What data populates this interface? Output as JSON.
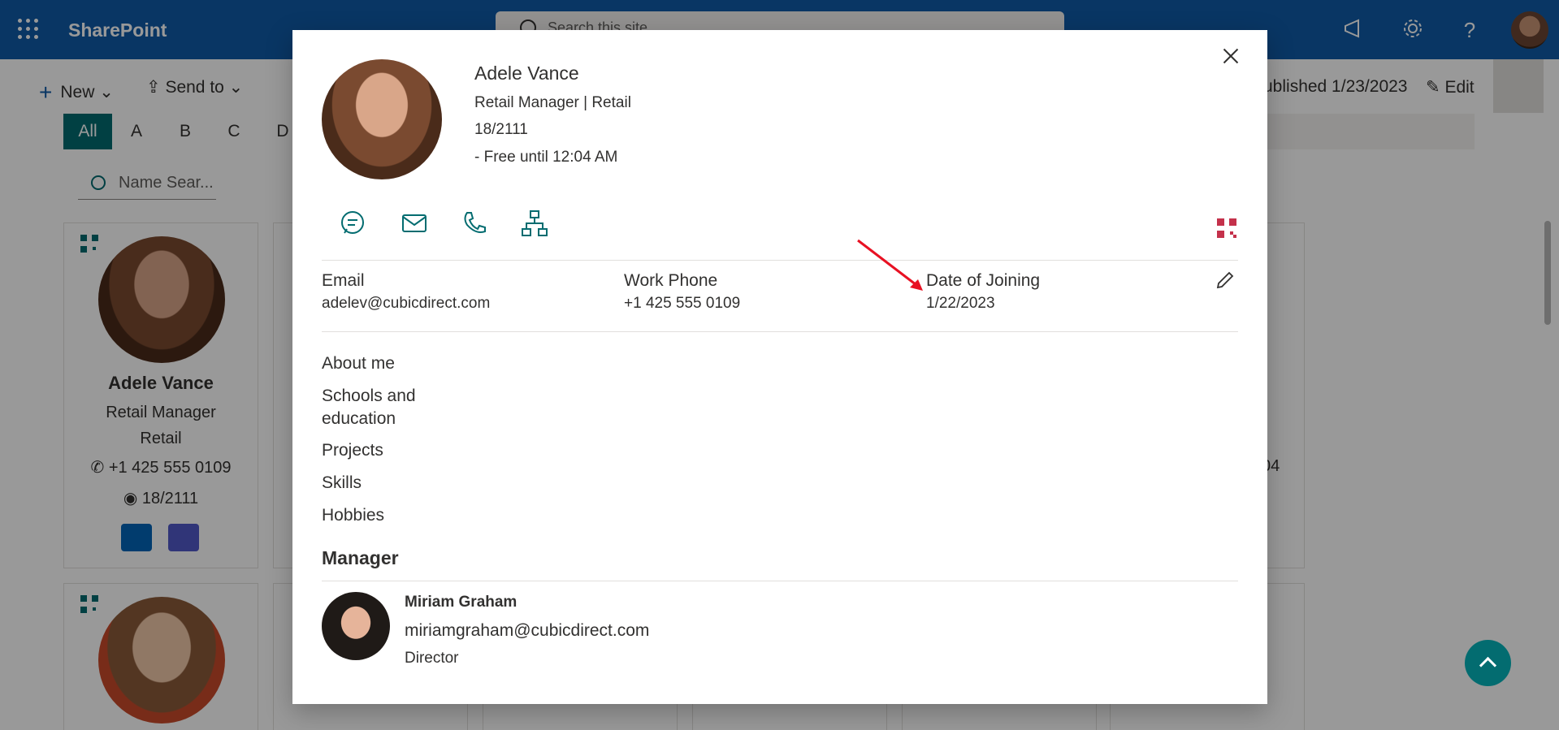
{
  "app": {
    "brand": "SharePoint",
    "search_placeholder": "Search this site"
  },
  "suite_icons": [
    "megaphone-icon",
    "gear-icon",
    "help-icon"
  ],
  "command_bar": {
    "new_label": "New",
    "send_to_label": "Send to",
    "published_label": "ublished 1/23/2023",
    "edit_label": "Edit"
  },
  "alphabet": [
    "All",
    "A",
    "B",
    "C",
    "D"
  ],
  "name_search_placeholder": "Name Sear...",
  "card": {
    "name": "Adele Vance",
    "title": "Retail Manager",
    "department": "Retail",
    "phone": "+1 425 555 0109",
    "office": "18/2111"
  },
  "partial_text": {
    "right_card_fragment": "04"
  },
  "profile": {
    "name": "Adele Vance",
    "title_dept": "Retail Manager | Retail",
    "office": "18/2111",
    "availability": "- Free until 12:04 AM"
  },
  "fields": [
    {
      "label": "Email",
      "value": "adelev@cubicdirect.com"
    },
    {
      "label": "Work Phone",
      "value": "+1 425 555 0109"
    },
    {
      "label": "Date of Joining",
      "value": "1/22/2023"
    }
  ],
  "sections": {
    "about": "About me",
    "schools_line1": "Schools and",
    "schools_line2": "education",
    "projects": "Projects",
    "skills": "Skills",
    "hobbies": "Hobbies"
  },
  "manager": {
    "heading": "Manager",
    "name": "Miriam Graham",
    "email": "miriamgraham@cubicdirect.com",
    "role": "Director"
  },
  "colors": {
    "suite": "#0f5ba7",
    "accent": "#036c70",
    "qr_red": "#c4314b",
    "arrow": "#e81123"
  }
}
